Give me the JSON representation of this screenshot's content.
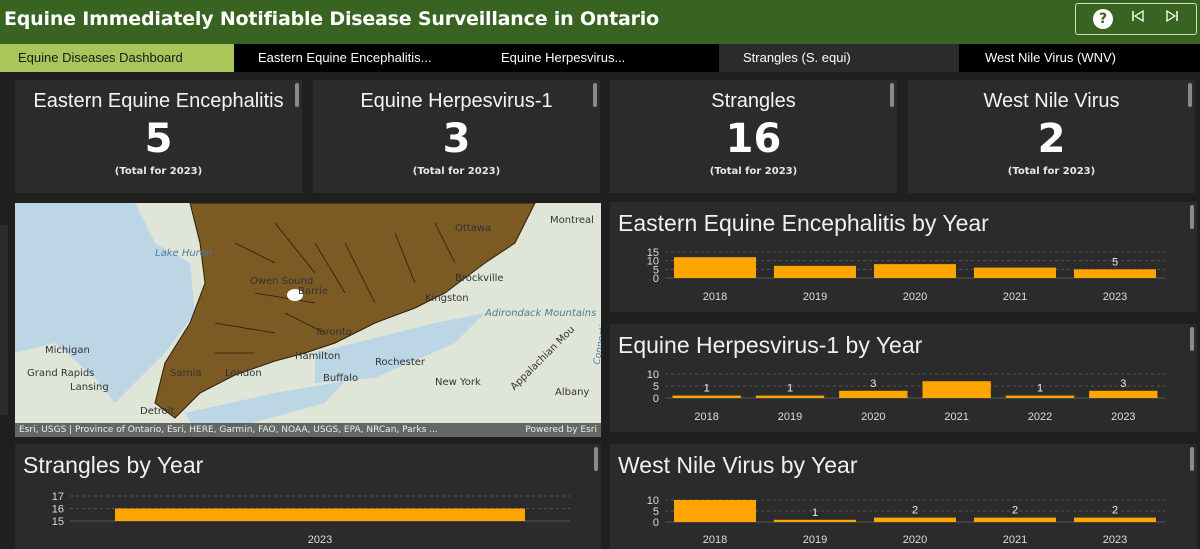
{
  "header": {
    "title": "Equine Immediately Notifiable Disease Surveillance in Ontario",
    "help_icon": "question-circle-icon",
    "prev_icon": "skip-previous-icon",
    "next_icon": "skip-next-icon"
  },
  "tabs": [
    {
      "label": "Equine Diseases Dashboard",
      "active": true
    },
    {
      "label": "Eastern Equine Encephalitis..."
    },
    {
      "label": "Equine Herpesvirus..."
    },
    {
      "label": "Strangles (S. equi)"
    },
    {
      "label": "West Nile Virus (WNV)"
    }
  ],
  "kpis": [
    {
      "title": "Eastern Equine Encephalitis",
      "value": "5",
      "note": "(Total for 2023)"
    },
    {
      "title": "Equine Herpesvirus-1",
      "value": "3",
      "note": "(Total for 2023)"
    },
    {
      "title": "Strangles",
      "value": "16",
      "note": "(Total for 2023)"
    },
    {
      "title": "West Nile Virus",
      "value": "2",
      "note": "(Total for 2023)"
    }
  ],
  "map": {
    "attribution": "Esri, USGS | Province of Ontario, Esri, HERE, Garmin, FAO, NOAA, USGS, EPA, NRCan, Parks ...",
    "powered_by": "Powered by Esri",
    "labels": [
      "Montreal",
      "Ottawa",
      "Lake Huron",
      "Owen Sound",
      "Barrie",
      "Brockville",
      "Kingston",
      "Adirondack Mountains",
      "Toronto",
      "Michigan",
      "Hamilton",
      "Rochester",
      "Appalachian Mou",
      "Grand Rapids",
      "Lansing",
      "Sarnia",
      "London",
      "Buffalo",
      "New York",
      "Albany",
      "Detroit",
      "Connecticut"
    ]
  },
  "colors": {
    "bar": "#ffa500",
    "header": "#386320",
    "active_tab": "#a9c65b",
    "card": "#2b2b2b"
  },
  "chart_data": [
    {
      "type": "bar",
      "title": "Eastern Equine Encephalitis by Year",
      "categories": [
        "2018",
        "2019",
        "2020",
        "2021",
        "2023"
      ],
      "values": [
        12,
        7,
        8,
        6,
        5
      ],
      "data_labels": [
        "",
        "",
        "",
        "",
        "5"
      ],
      "yticks": [
        "15",
        "10",
        "5",
        "0"
      ],
      "ylim": [
        0,
        15
      ]
    },
    {
      "type": "bar",
      "title": "Equine Herpesvirus-1 by Year",
      "categories": [
        "2018",
        "2019",
        "2020",
        "2021",
        "2022",
        "2023"
      ],
      "values": [
        1,
        1,
        3,
        7,
        1,
        3
      ],
      "data_labels": [
        "1",
        "1",
        "3",
        "",
        "1",
        "3"
      ],
      "yticks": [
        "10",
        "5",
        "0"
      ],
      "ylim": [
        0,
        10
      ]
    },
    {
      "type": "bar",
      "title": "Strangles by Year",
      "categories": [
        "2023"
      ],
      "values": [
        16
      ],
      "data_labels": [
        ""
      ],
      "yticks": [
        "17",
        "16",
        "15"
      ],
      "ylim": [
        15,
        17
      ]
    },
    {
      "type": "bar",
      "title": "West Nile Virus by Year",
      "categories": [
        "2018",
        "2019",
        "2020",
        "2021",
        "2023"
      ],
      "values": [
        10,
        1,
        2,
        2,
        2
      ],
      "data_labels": [
        "",
        "1",
        "2",
        "2",
        "2"
      ],
      "yticks": [
        "10",
        "5",
        "0"
      ],
      "ylim": [
        0,
        10
      ]
    }
  ]
}
